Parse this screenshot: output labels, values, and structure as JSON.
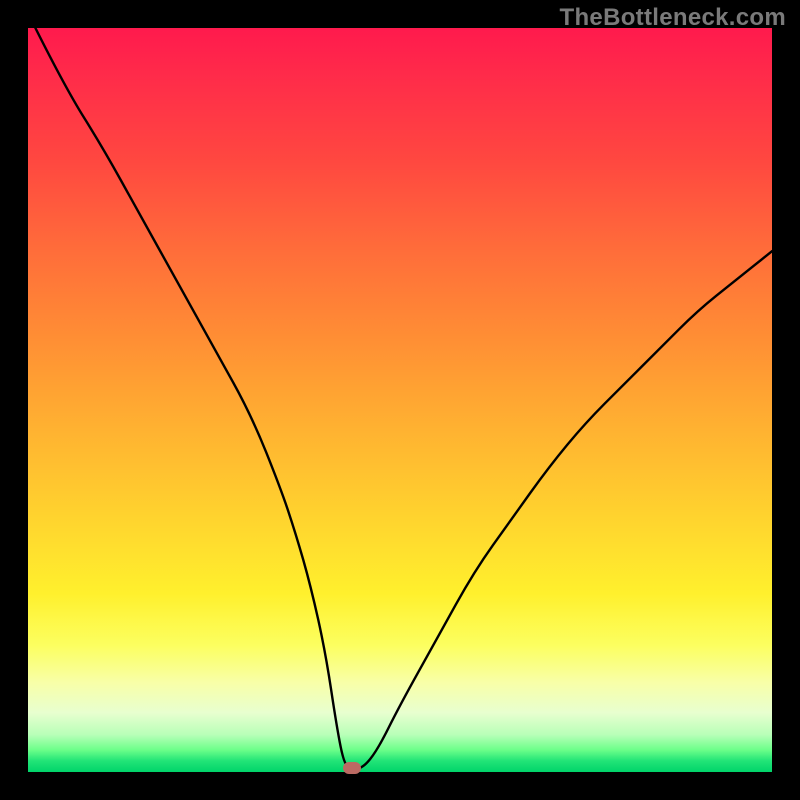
{
  "watermark": "TheBottleneck.com",
  "chart_data": {
    "type": "line",
    "title": "",
    "xlabel": "",
    "ylabel": "",
    "xlim": [
      0,
      100
    ],
    "ylim": [
      0,
      100
    ],
    "grid": false,
    "legend": false,
    "series": [
      {
        "name": "bottleneck-curve",
        "x": [
          1,
          5,
          10,
          15,
          20,
          25,
          30,
          34,
          36,
          38,
          40,
          41.5,
          42.5,
          43.5,
          45,
          47,
          50,
          55,
          60,
          65,
          70,
          75,
          80,
          85,
          90,
          95,
          100
        ],
        "values": [
          100,
          92,
          84,
          75,
          66,
          57,
          48,
          38,
          32,
          25,
          16,
          6,
          1,
          0.5,
          0.5,
          3,
          9,
          18,
          27,
          34,
          41,
          47,
          52,
          57,
          62,
          66,
          70
        ]
      }
    ],
    "marker": {
      "x": 43.5,
      "y": 0.5,
      "color": "#bb6a63"
    },
    "background_gradient": {
      "orientation": "vertical",
      "stops": [
        {
          "pos": 0.0,
          "color": "#ff1a4d"
        },
        {
          "pos": 0.3,
          "color": "#ff6d3a"
        },
        {
          "pos": 0.66,
          "color": "#ffd42e"
        },
        {
          "pos": 0.88,
          "color": "#f8ffa8"
        },
        {
          "pos": 1.0,
          "color": "#00d46a"
        }
      ]
    }
  }
}
